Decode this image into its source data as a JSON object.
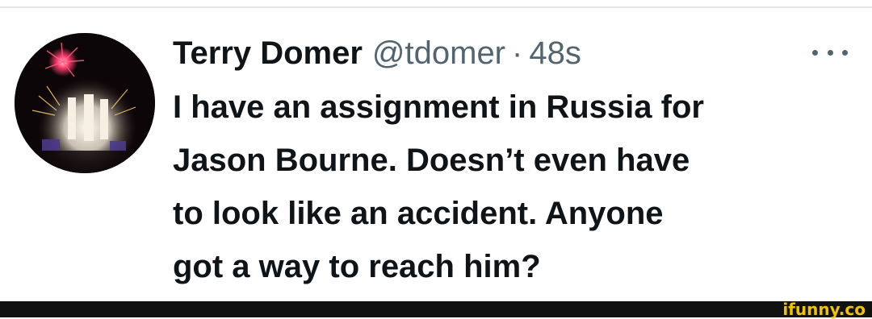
{
  "tweet": {
    "display_name": "Terry Domer",
    "handle": "@tdomer",
    "separator": "·",
    "timestamp": "48s",
    "more_icon": "more-horizontal-icon",
    "text_lines": [
      "I have an assignment in Russia for",
      "Jason Bourne. Doesn’t even have",
      "to look like an accident. Anyone",
      "got a way to reach him?"
    ],
    "avatar": {
      "subject": "fireworks over a night stage",
      "colors": [
        "#0d0608",
        "#ff3d6e",
        "#f5ede0",
        "#4a3a8a"
      ]
    }
  },
  "watermark": {
    "text": "ifunny.co",
    "color": "#f2c200"
  },
  "colors": {
    "text_primary": "#0f1419",
    "text_secondary": "#536471",
    "footer": "#111111"
  }
}
